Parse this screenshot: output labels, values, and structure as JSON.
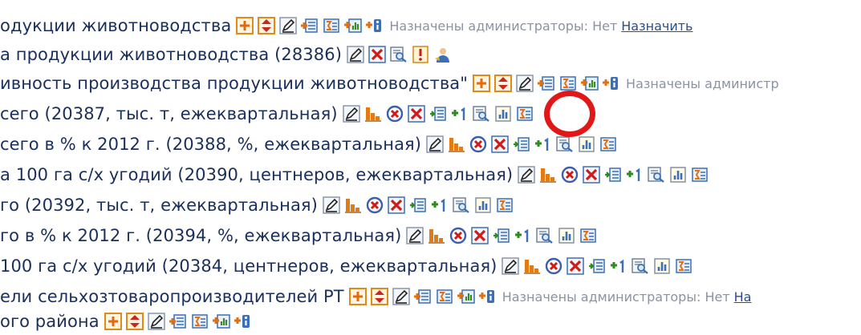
{
  "rows": [
    {
      "text": "одукции животноводства",
      "admin_text": "Назначены администраторы: Нет",
      "admin_link": "Назначить"
    },
    {
      "text": "а продукции животноводства (28386)"
    },
    {
      "text": "ивность производства продукции животноводства\"",
      "admin_text": "Назначены администр"
    },
    {
      "text": "сего (20387, тыс. т, ежеквартальная)"
    },
    {
      "text": "сего в % к 2012 г. (20388, %, ежеквартальная)"
    },
    {
      "text": "а 100 га с/х угодий (20390, центнеров, ежеквартальная)"
    },
    {
      "text": "го (20392, тыс. т, ежеквартальная)"
    },
    {
      "text": "го в % к 2012 г. (20394, %, ежеквартальная)"
    },
    {
      "text": "100 га с/х угодий (20384, центнеров, ежеквартальная)"
    },
    {
      "text": "ели сельхозтоваропроизводителей РТ",
      "admin_text": "Назначены администраторы: Нет",
      "admin_link": "На"
    },
    {
      "text": "ого района"
    }
  ],
  "colors": {
    "text": "#1a2f5a",
    "admin_text": "#8a93a3",
    "highlight": "#e01818"
  }
}
